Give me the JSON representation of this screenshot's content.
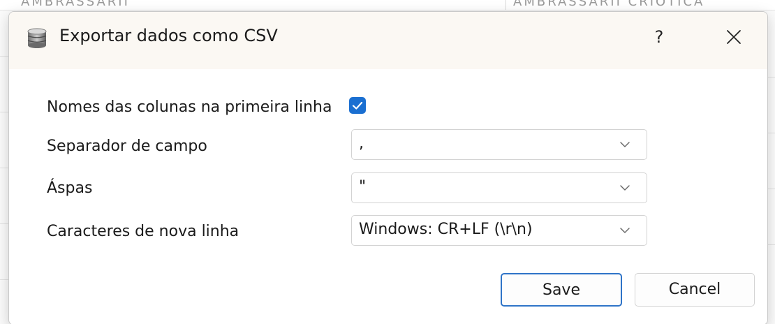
{
  "background": {
    "strip_left": "AMBRASSARII",
    "strip_right": "AMBRASSARII   CRIOTICA"
  },
  "dialog": {
    "title": "Exportar dados como CSV",
    "title_icon": "database-icon",
    "help_label": "?",
    "close_icon": "close-icon"
  },
  "form": {
    "column_names_label": "Nomes das colunas na primeira linha",
    "column_names_checked": true,
    "field_separator_label": "Separador de campo",
    "field_separator_value": ",",
    "quotes_label": "Áspas",
    "quotes_value": "\"",
    "newline_label": "Caracteres de nova linha",
    "newline_value": "Windows: CR+LF (\\r\\n)"
  },
  "buttons": {
    "save_label": "Save",
    "cancel_label": "Cancel"
  },
  "colors": {
    "accent": "#1a6fd1",
    "titlebar": "#fbf8f3",
    "default_button_border": "#2f74c8"
  }
}
